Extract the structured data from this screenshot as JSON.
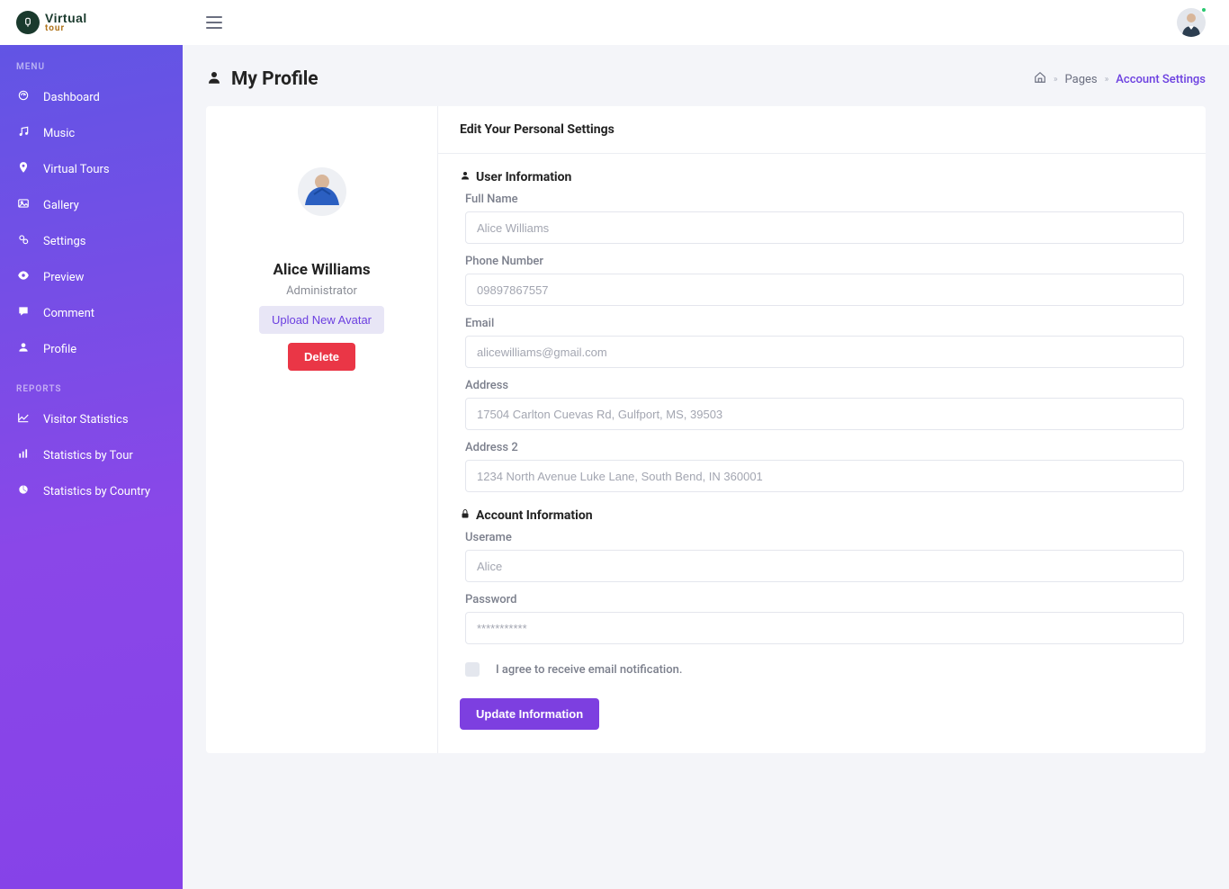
{
  "brand": {
    "top": "Virtual",
    "bottom": "tour"
  },
  "sidebar": {
    "menu_label": "MENU",
    "reports_label": "REPORTS",
    "items": [
      {
        "label": "Dashboard",
        "icon": "dashboard"
      },
      {
        "label": "Music",
        "icon": "music"
      },
      {
        "label": "Virtual Tours",
        "icon": "pin"
      },
      {
        "label": "Gallery",
        "icon": "image"
      },
      {
        "label": "Settings",
        "icon": "cogs"
      },
      {
        "label": "Preview",
        "icon": "eye"
      },
      {
        "label": "Comment",
        "icon": "comment"
      },
      {
        "label": "Profile",
        "icon": "user"
      }
    ],
    "reports": [
      {
        "label": "Visitor Statistics",
        "icon": "chartline"
      },
      {
        "label": "Statistics by Tour",
        "icon": "chartbar"
      },
      {
        "label": "Statistics by Country",
        "icon": "pie"
      }
    ]
  },
  "breadcrumb": {
    "pages": "Pages",
    "current": "Account Settings"
  },
  "page_title": "My Profile",
  "profile": {
    "name": "Alice Williams",
    "role": "Administrator",
    "upload_btn": "Upload New Avatar",
    "delete_btn": "Delete"
  },
  "card_head": "Edit Your Personal Settings",
  "sections": {
    "user_info": "User Information",
    "account_info": "Account Information"
  },
  "form": {
    "full_name_label": "Full Name",
    "full_name_placeholder": "Alice Williams",
    "phone_label": "Phone Number",
    "phone_placeholder": "09897867557",
    "email_label": "Email",
    "email_placeholder": "alicewilliams@gmail.com",
    "address_label": "Address",
    "address_placeholder": "17504 Carlton Cuevas Rd, Gulfport, MS, 39503",
    "address2_label": "Address 2",
    "address2_placeholder": "1234 North Avenue Luke Lane, South Bend, IN 360001",
    "username_label": "Userame",
    "username_placeholder": "Alice",
    "password_label": "Password",
    "password_placeholder": "***********"
  },
  "checkbox_label": "I agree to receive email notification.",
  "submit_label": "Update Information"
}
